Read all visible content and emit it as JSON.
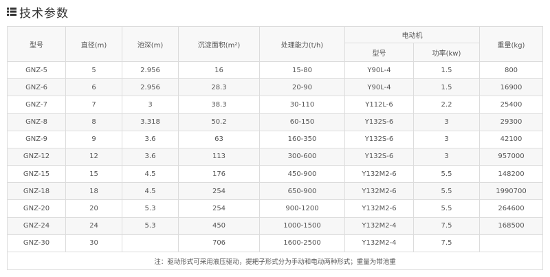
{
  "title": "技术参数",
  "table": {
    "headers": {
      "model": "型号",
      "diameter": "直径(m)",
      "depth": "池深(m)",
      "area": "沉淀面积(m²)",
      "capacity": "处理能力(t/h)",
      "motor": "电动机",
      "motor_model": "型号",
      "motor_power": "功率(kw)",
      "weight": "重量(kg)"
    },
    "rows": [
      [
        "GNZ-5",
        "5",
        "2.956",
        "16",
        "15-80",
        "Y90L-4",
        "1.5",
        "800"
      ],
      [
        "GNZ-6",
        "6",
        "2.956",
        "28.3",
        "20-90",
        "Y90L-4",
        "1.5",
        "16900"
      ],
      [
        "GNZ-7",
        "7",
        "3",
        "38.3",
        "30-110",
        "Y112L-6",
        "2.2",
        "25400"
      ],
      [
        "GNZ-8",
        "8",
        "3.318",
        "50.2",
        "60-150",
        "Y132S-6",
        "3",
        "29300"
      ],
      [
        "GNZ-9",
        "9",
        "3.6",
        "63",
        "160-350",
        "Y132S-6",
        "3",
        "42100"
      ],
      [
        "GNZ-12",
        "12",
        "3.6",
        "113",
        "300-600",
        "Y132S-6",
        "3",
        "957000"
      ],
      [
        "GNZ-15",
        "15",
        "4.5",
        "176",
        "450-900",
        "Y132M2-6",
        "5.5",
        "148200"
      ],
      [
        "GNZ-18",
        "18",
        "4.5",
        "254",
        "650-900",
        "Y132M2-6",
        "5.5",
        "1990700"
      ],
      [
        "GNZ-20",
        "20",
        "5.3",
        "254",
        "900-1200",
        "Y132M2-6",
        "5.5",
        "264600"
      ],
      [
        "GNZ-24",
        "24",
        "5.3",
        "450",
        "1000-1500",
        "Y132M2-4",
        "7.5",
        "168500"
      ],
      [
        "GNZ-30",
        "30",
        "",
        "706",
        "1600-2500",
        "Y132M2-4",
        "7.5",
        ""
      ]
    ],
    "note": "注：驱动形式可采用液压驱动，提耙子形式分为手动和电动两种形式；重量为带池重"
  },
  "icon": "list-icon"
}
